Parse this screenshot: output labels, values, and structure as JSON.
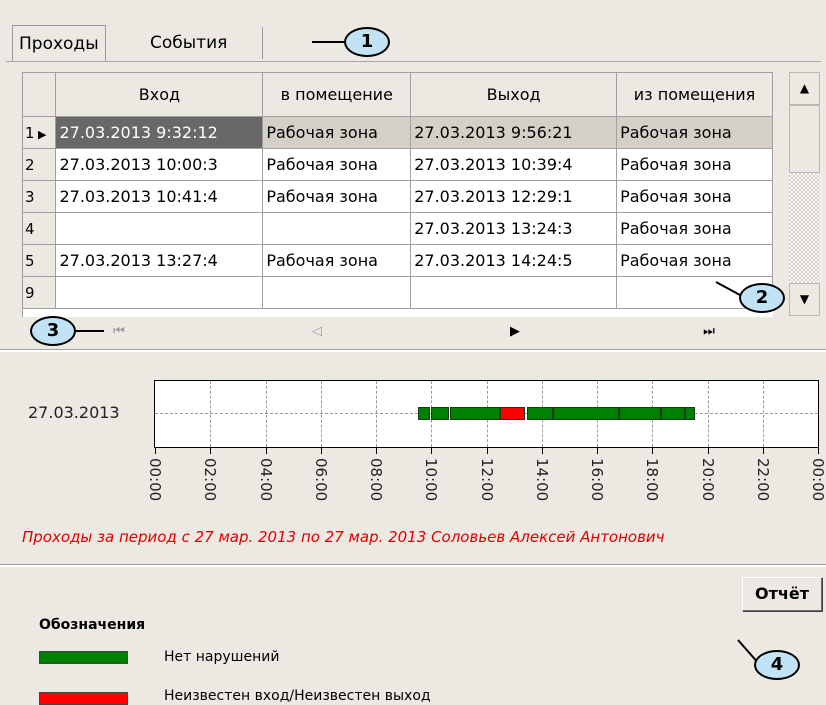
{
  "tabs": [
    {
      "label": "Проходы",
      "active": true
    },
    {
      "label": "События",
      "active": false
    }
  ],
  "table": {
    "columns": [
      "Вход",
      "в помещение",
      "Выход",
      "из помещения"
    ],
    "rows": [
      {
        "indicator": "1",
        "current": true,
        "cells": [
          "27.03.2013 9:32:12",
          "Рабочая зона",
          "27.03.2013 9:56:21",
          "Рабочая зона"
        ]
      },
      {
        "indicator": "2",
        "cells": [
          "27.03.2013 10:00:3",
          "Рабочая зона",
          "27.03.2013 10:39:4",
          "Рабочая зона"
        ]
      },
      {
        "indicator": "3",
        "cells": [
          "27.03.2013 10:41:4",
          "Рабочая зона",
          "27.03.2013 12:29:1",
          "Рабочая зона"
        ]
      },
      {
        "indicator": "4",
        "cells": [
          "",
          "",
          "27.03.2013 13:24:3",
          "Рабочая зона"
        ]
      },
      {
        "indicator": "5",
        "cells": [
          "27.03.2013 13:27:4",
          "Рабочая зона",
          "27.03.2013 14:24:5",
          "Рабочая зона"
        ]
      },
      {
        "indicator": "9",
        "cells": [
          "",
          "",
          "",
          ""
        ]
      }
    ]
  },
  "navigator": {
    "first_icon": "first-record-icon",
    "prev_icon": "prev-record-icon",
    "next_icon": "next-record-icon",
    "last_icon": "last-record-icon"
  },
  "chart_data": {
    "type": "bar",
    "orientation": "horizontal-timeline",
    "category": "27.03.2013",
    "x_ticks": [
      "00:00",
      "02:00",
      "04:00",
      "06:00",
      "08:00",
      "10:00",
      "12:00",
      "14:00",
      "16:00",
      "18:00",
      "20:00",
      "22:00",
      "00:00"
    ],
    "x_range_hours": [
      0,
      24
    ],
    "grid": true,
    "segments": [
      {
        "start": 9.53,
        "end": 9.94,
        "status": "ok"
      },
      {
        "start": 10.0,
        "end": 10.66,
        "status": "ok"
      },
      {
        "start": 10.69,
        "end": 12.49,
        "status": "ok"
      },
      {
        "start": 12.49,
        "end": 13.41,
        "status": "unknown"
      },
      {
        "start": 13.46,
        "end": 14.42,
        "status": "ok"
      },
      {
        "start": 14.42,
        "end": 16.8,
        "status": "ok"
      },
      {
        "start": 16.8,
        "end": 18.3,
        "status": "ok"
      },
      {
        "start": 18.3,
        "end": 19.2,
        "status": "ok"
      },
      {
        "start": 19.2,
        "end": 19.55,
        "status": "ok"
      }
    ],
    "colors": {
      "ok": "#008000",
      "unknown": "#ff0000"
    }
  },
  "caption": "Проходы за период с 27 мар. 2013  по 27 мар. 2013 Соловьев Алексей Антонович",
  "legend": {
    "title": "Обозначения",
    "items": [
      {
        "label": "Нет нарушений",
        "color": "#008000"
      },
      {
        "label": "Неизвестен вход/Неизвестен выход",
        "color": "#ff0000"
      }
    ]
  },
  "report_button": "Отчёт",
  "callouts": [
    "1",
    "2",
    "3",
    "4"
  ]
}
